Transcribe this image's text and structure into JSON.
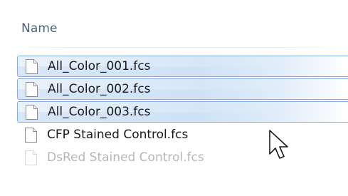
{
  "header": {
    "column_name": "Name"
  },
  "files": [
    {
      "name": "All_Color_001.fcs",
      "selected": true
    },
    {
      "name": "All_Color_002.fcs",
      "selected": true
    },
    {
      "name": "All_Color_003.fcs",
      "selected": true
    },
    {
      "name": "CFP Stained Control.fcs",
      "selected": false
    },
    {
      "name": "DsRed Stained Control.fcs",
      "selected": false
    }
  ],
  "colors": {
    "selection_border": "#84acdd",
    "selection_fill": "#cfe2f6",
    "header_text": "#4c607a"
  },
  "icons": {
    "file": "document-icon",
    "pointer": "mouse-pointer-icon"
  }
}
